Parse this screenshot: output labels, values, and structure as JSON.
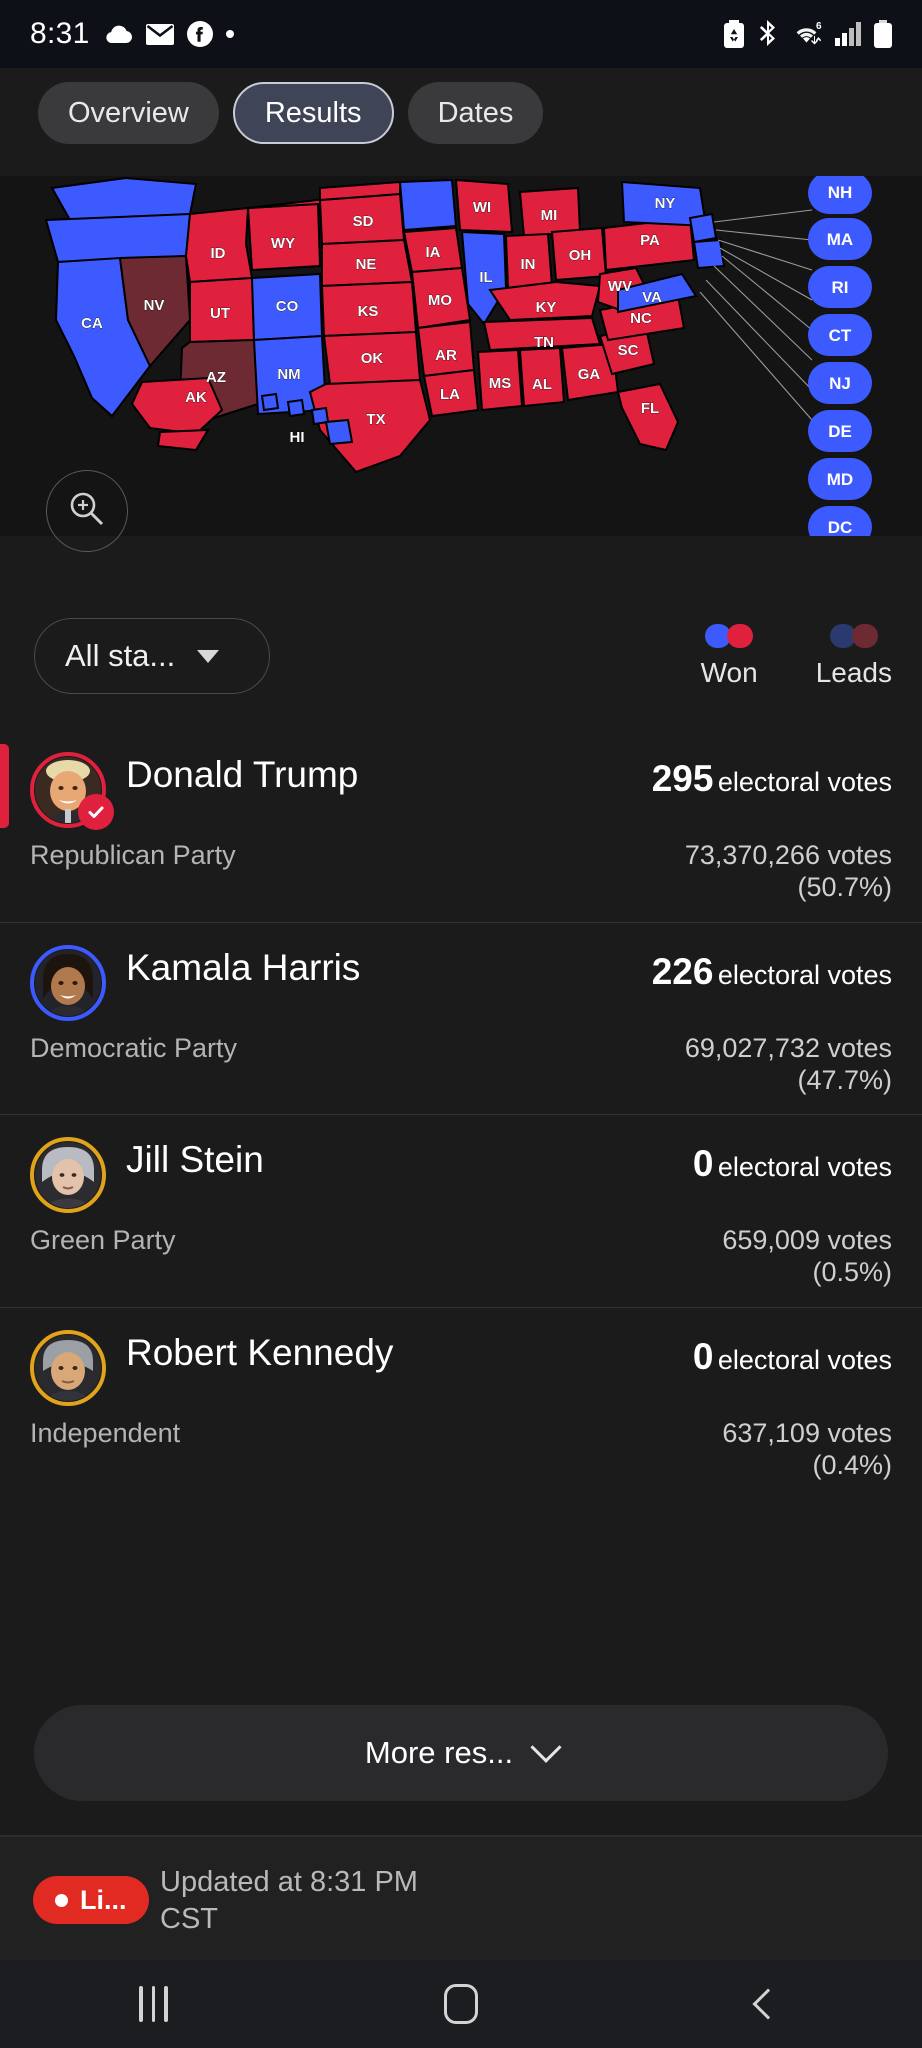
{
  "statusbar": {
    "time": "8:31",
    "left_icons": [
      "cloud-icon",
      "mail-icon",
      "facebook-icon",
      "dot-icon"
    ],
    "right_icons": [
      "battery-saver-icon",
      "bluetooth-icon",
      "wifi-6-icon",
      "cellular-signal-icon",
      "battery-icon"
    ]
  },
  "tabs": [
    {
      "label": "Overview",
      "active": false
    },
    {
      "label": "Results",
      "active": true
    },
    {
      "label": "Dates",
      "active": false
    }
  ],
  "map": {
    "zoom_button": "zoom-in-icon",
    "colors": {
      "won_blue": "#3d5afe",
      "won_red": "#e0213e",
      "lead_blue": "#2a3a6e",
      "lead_red": "#6e2a33",
      "background": "#141414",
      "border": "#000000"
    },
    "callout_pills": [
      "NH",
      "MA",
      "RI",
      "CT",
      "NJ",
      "DE",
      "MD",
      "DC"
    ],
    "states": [
      {
        "code": "CA",
        "status": "won_blue"
      },
      {
        "code": "NV",
        "status": "lead_red"
      },
      {
        "code": "ID",
        "status": "won_red"
      },
      {
        "code": "WY",
        "status": "won_red"
      },
      {
        "code": "UT",
        "status": "won_red"
      },
      {
        "code": "AZ",
        "status": "lead_red"
      },
      {
        "code": "CO",
        "status": "won_blue"
      },
      {
        "code": "NM",
        "status": "won_blue"
      },
      {
        "code": "SD",
        "status": "won_red"
      },
      {
        "code": "NE",
        "status": "won_red"
      },
      {
        "code": "KS",
        "status": "won_red"
      },
      {
        "code": "OK",
        "status": "won_red"
      },
      {
        "code": "TX",
        "status": "won_red"
      },
      {
        "code": "MO",
        "status": "won_red"
      },
      {
        "code": "AR",
        "status": "won_red"
      },
      {
        "code": "LA",
        "status": "won_red"
      },
      {
        "code": "IA",
        "status": "won_red"
      },
      {
        "code": "WI",
        "status": "won_red"
      },
      {
        "code": "IL",
        "status": "won_blue"
      },
      {
        "code": "MI",
        "status": "won_red"
      },
      {
        "code": "IN",
        "status": "won_red"
      },
      {
        "code": "OH",
        "status": "won_red"
      },
      {
        "code": "KY",
        "status": "won_red"
      },
      {
        "code": "TN",
        "status": "won_red"
      },
      {
        "code": "MS",
        "status": "won_red"
      },
      {
        "code": "AL",
        "status": "won_red"
      },
      {
        "code": "GA",
        "status": "won_red"
      },
      {
        "code": "SC",
        "status": "won_red"
      },
      {
        "code": "NC",
        "status": "won_red"
      },
      {
        "code": "WV",
        "status": "won_red"
      },
      {
        "code": "VA",
        "status": "won_blue"
      },
      {
        "code": "PA",
        "status": "won_red"
      },
      {
        "code": "NY",
        "status": "won_blue"
      },
      {
        "code": "FL",
        "status": "won_red"
      },
      {
        "code": "AK",
        "status": "won_red"
      },
      {
        "code": "HI",
        "status": "won_blue"
      }
    ]
  },
  "controls": {
    "state_filter": "All sta...",
    "legend": [
      {
        "label": "Won",
        "blue": "#3d5afe",
        "red": "#e0213e"
      },
      {
        "label": "Leads",
        "blue": "#2a3a6e",
        "red": "#6e2a33"
      }
    ]
  },
  "candidates": [
    {
      "name": "Donald Trump",
      "party": "Republican Party",
      "electoral_votes": "295",
      "electoral_label": "electoral votes",
      "popular_votes": "73,370,266 votes",
      "percent": "(50.7%)",
      "ring_color": "#e0213e",
      "winner": true
    },
    {
      "name": "Kamala Harris",
      "party": "Democratic Party",
      "electoral_votes": "226",
      "electoral_label": "electoral votes",
      "popular_votes": "69,027,732 votes",
      "percent": "(47.7%)",
      "ring_color": "#3d5afe",
      "winner": false
    },
    {
      "name": "Jill Stein",
      "party": "Green Party",
      "electoral_votes": "0",
      "electoral_label": "electoral votes",
      "popular_votes": "659,009 votes",
      "percent": "(0.5%)",
      "ring_color": "#e0a31a",
      "winner": false
    },
    {
      "name": "Robert Kennedy",
      "party": "Independent",
      "electoral_votes": "0",
      "electoral_label": "electoral votes",
      "popular_votes": "637,109 votes",
      "percent": "(0.4%)",
      "ring_color": "#e0a31a",
      "winner": false
    }
  ],
  "more_button": {
    "label": "More res...",
    "icon": "chevron-down-icon"
  },
  "footer": {
    "live_badge": "Li...",
    "updated": "Updated at 8:31 PM CST"
  },
  "navbar": {
    "recents": "recents-icon",
    "home": "home-icon",
    "back": "back-icon"
  }
}
